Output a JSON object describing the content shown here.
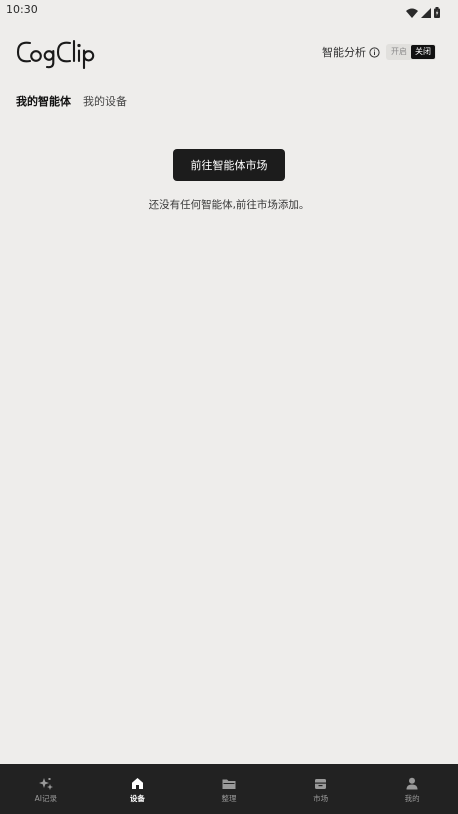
{
  "status_bar": {
    "time": "10:30",
    "icons": [
      "wifi-icon",
      "signal-icon",
      "battery-icon"
    ]
  },
  "header": {
    "logo_text": "CogClip",
    "analysis_label": "智能分析",
    "toggle": {
      "on_label": "开启",
      "off_label": "关闭",
      "selected": "关闭"
    }
  },
  "tabs": [
    {
      "label": "我的智能体",
      "active": true
    },
    {
      "label": "我的设备",
      "active": false
    }
  ],
  "empty_state": {
    "button_label": "前往智能体市场",
    "message": "还没有任何智能体,前往市场添加。"
  },
  "bottom_nav": [
    {
      "label": "AI记录",
      "icon": "sparkle-icon",
      "active": false
    },
    {
      "label": "设备",
      "icon": "home-icon",
      "active": true
    },
    {
      "label": "整理",
      "icon": "folder-icon",
      "active": false
    },
    {
      "label": "市场",
      "icon": "store-icon",
      "active": false
    },
    {
      "label": "我的",
      "icon": "person-icon",
      "active": false
    }
  ],
  "colors": {
    "background": "#eeedeb",
    "nav_background": "#222222",
    "primary_button": "#1c1c1c"
  }
}
